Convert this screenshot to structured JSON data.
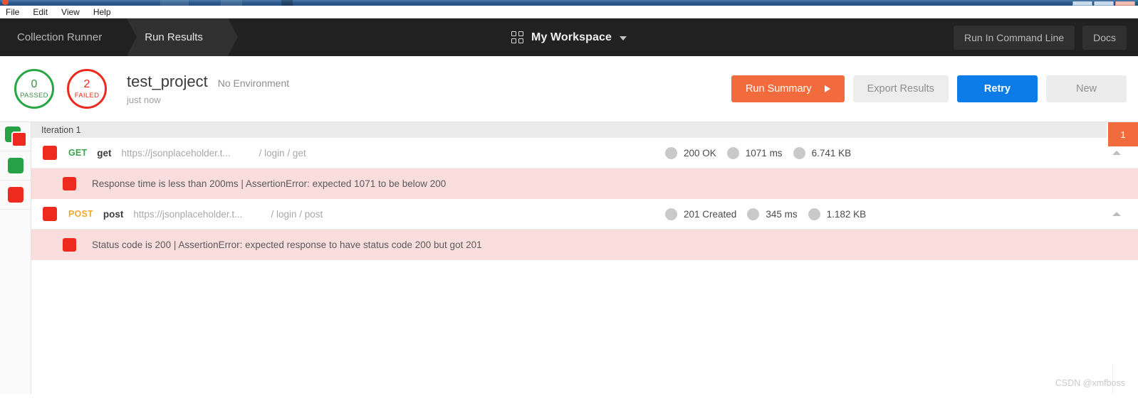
{
  "menubar": {
    "items": [
      "File",
      "Edit",
      "View",
      "Help"
    ]
  },
  "header": {
    "crumbs": [
      {
        "label": "Collection Runner",
        "active": false
      },
      {
        "label": "Run Results",
        "active": true
      }
    ],
    "workspace": {
      "icon": "grid-icon",
      "name": "My Workspace",
      "caret": "chevron-down-icon"
    },
    "actions": [
      {
        "label": "Run In Command Line"
      },
      {
        "label": "Docs"
      }
    ]
  },
  "summary": {
    "passed": {
      "count": "0",
      "label": "PASSED",
      "color": "#28a745"
    },
    "failed": {
      "count": "2",
      "label": "FAILED",
      "color": "#ee2a1e"
    },
    "run_title": "test_project",
    "environment": "No Environment",
    "timestamp": "just now",
    "buttons": {
      "run_summary": "Run Summary",
      "export_results": "Export Results",
      "retry": "Retry",
      "new": "New"
    },
    "colors": {
      "run_summary_bg": "#f26b3d",
      "retry_bg": "#0b7ce8",
      "neutral_bg": "#ededed"
    }
  },
  "rail": {
    "items": [
      {
        "name": "filter-all",
        "icons": [
          "green-square",
          "red-square"
        ]
      },
      {
        "name": "filter-passed",
        "icons": [
          "green-square"
        ]
      },
      {
        "name": "filter-failed",
        "icons": [
          "red-square"
        ]
      }
    ]
  },
  "results": {
    "iteration_label": "Iteration 1",
    "iteration_badge": "1",
    "rows": [
      {
        "status_badge": "red-square",
        "method": "GET",
        "method_class": "get",
        "name": "get",
        "url": "https://jsonplaceholder.t...",
        "path": "/ login / get",
        "stats": [
          {
            "label": "200 OK"
          },
          {
            "label": "1071 ms"
          },
          {
            "label": "6.741 KB"
          }
        ],
        "collapse_icon": "chevron-up-icon",
        "assertion": {
          "badge": "red-square",
          "text": "Response time is less than 200ms | AssertionError: expected 1071 to be below 200"
        }
      },
      {
        "status_badge": "red-square",
        "method": "POST",
        "method_class": "post",
        "name": "post",
        "url": "https://jsonplaceholder.t...",
        "path": "/ login / post",
        "stats": [
          {
            "label": "201 Created"
          },
          {
            "label": "345 ms"
          },
          {
            "label": "1.182 KB"
          }
        ],
        "collapse_icon": "chevron-up-icon",
        "assertion": {
          "badge": "red-square",
          "text": "Status code is 200 | AssertionError: expected response to have status code 200 but got 201"
        }
      }
    ]
  },
  "watermark": "CSDN @xmfboss"
}
